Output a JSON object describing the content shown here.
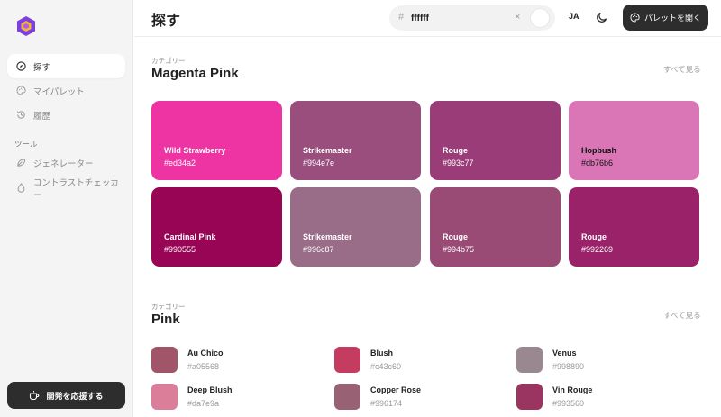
{
  "sidebar": {
    "nav": [
      {
        "label": "探す",
        "icon": "compass-icon",
        "active": true
      },
      {
        "label": "マイパレット",
        "icon": "palette-icon",
        "active": false
      },
      {
        "label": "履歴",
        "icon": "history-icon",
        "active": false
      }
    ],
    "section_label": "ツール",
    "tools": [
      {
        "label": "ジェネレーター",
        "icon": "leaf-icon"
      },
      {
        "label": "コントラストチェッカー",
        "icon": "droplet-icon"
      }
    ],
    "support_label": "開発を応援する"
  },
  "header": {
    "title": "探す",
    "search": {
      "value": "ffffff",
      "hash": "#",
      "clear": "×",
      "swatch_color": "#ffffff"
    },
    "lang": "JA",
    "open_palette_label": "パレットを開く"
  },
  "sections": [
    {
      "category_label": "カテゴリー",
      "title": "Magenta Pink",
      "see_all": "すべて見る",
      "cards": [
        {
          "name": "Wild Strawberry",
          "hex": "#ed34a2",
          "text": "dark"
        },
        {
          "name": "Strikemaster",
          "hex": "#994e7e",
          "text": "dark"
        },
        {
          "name": "Rouge",
          "hex": "#993c77",
          "text": "dark"
        },
        {
          "name": "Hopbush",
          "hex": "#db76b6",
          "text": "light"
        },
        {
          "name": "Cardinal Pink",
          "hex": "#990555",
          "text": "dark"
        },
        {
          "name": "Strikemaster",
          "hex": "#996c87",
          "text": "dark"
        },
        {
          "name": "Rouge",
          "hex": "#994b75",
          "text": "dark"
        },
        {
          "name": "Rouge",
          "hex": "#992269",
          "text": "dark"
        }
      ]
    },
    {
      "category_label": "カテゴリー",
      "title": "Pink",
      "see_all": "すべて見る",
      "items": [
        {
          "name": "Au Chico",
          "hex": "#a05568"
        },
        {
          "name": "Blush",
          "hex": "#c43c60"
        },
        {
          "name": "Venus",
          "hex": "#998890"
        },
        {
          "name": "Deep Blush",
          "hex": "#da7e9a"
        },
        {
          "name": "Copper Rose",
          "hex": "#996174"
        },
        {
          "name": "Vin Rouge",
          "hex": "#993560"
        }
      ]
    }
  ],
  "colors": {
    "accent_dark": "#2d2d2d",
    "logo_purple": "#7b3fe4",
    "logo_yellow": "#f5b62e"
  }
}
